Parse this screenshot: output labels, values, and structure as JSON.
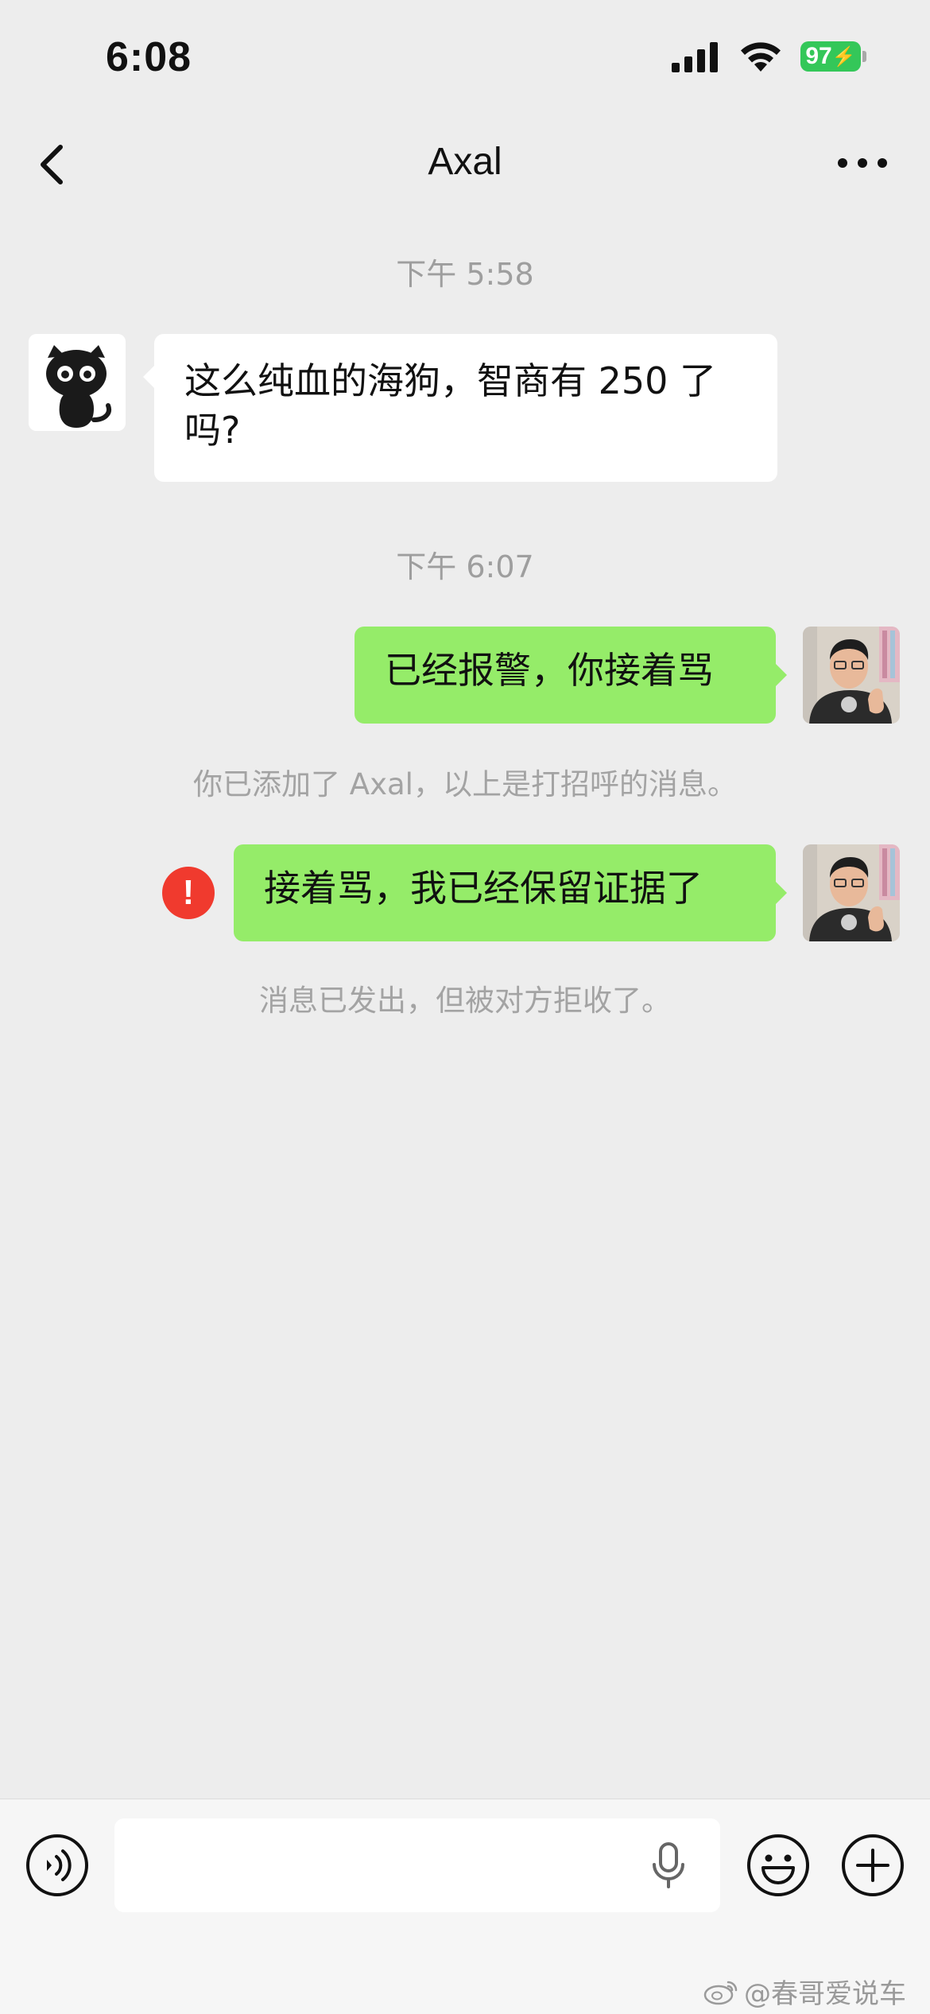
{
  "status_bar": {
    "time": "6:08",
    "battery": "97"
  },
  "nav": {
    "title": "Axal"
  },
  "messages": {
    "timestamp_1": "下午 5:58",
    "incoming_1": "这么纯血的海狗，智商有 250 了吗?",
    "timestamp_2": "下午 6:07",
    "outgoing_1": "已经报警，你接着骂",
    "system_1": "你已添加了 Axal，以上是打招呼的消息。",
    "outgoing_2": "接着骂，我已经保留证据了",
    "fail_mark": "!",
    "system_2": "消息已发出，但被对方拒收了。"
  },
  "colors": {
    "outgoing_bubble": "#95ec69",
    "incoming_bubble": "#ffffff",
    "error_badge": "#f03a2e",
    "battery": "#34c759",
    "background": "#ededed"
  },
  "input": {
    "placeholder": ""
  },
  "watermark": {
    "text": "@春哥爱说车"
  },
  "icons": [
    "back-icon",
    "more-icon",
    "voice-icon",
    "mic-icon",
    "emoji-icon",
    "plus-icon",
    "signal-icon",
    "wifi-icon",
    "battery-icon",
    "weibo-icon"
  ]
}
